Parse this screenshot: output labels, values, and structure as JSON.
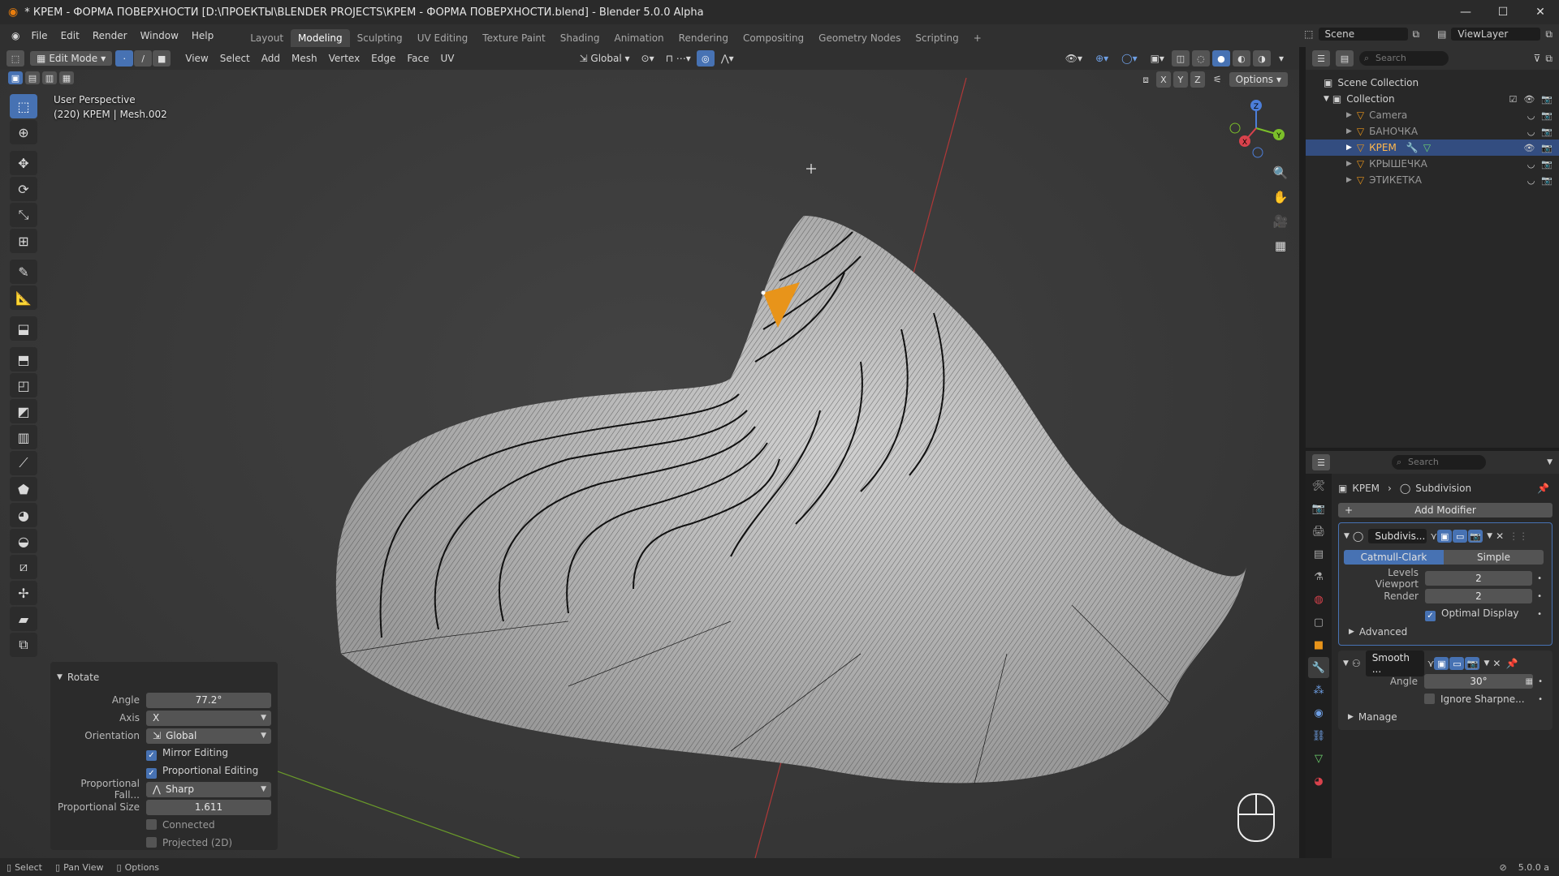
{
  "window": {
    "title": "* КРЕМ - ФОРМА ПОВЕРХНОСТИ [D:\\ПРОЕКТЫ\\BLENDER PROJECTS\\КРЕМ - ФОРМА ПОВЕРХНОСТИ.blend] - Blender 5.0.0 Alpha"
  },
  "menu": [
    "File",
    "Edit",
    "Render",
    "Window",
    "Help"
  ],
  "workspaces": [
    "Layout",
    "Modeling",
    "Sculpting",
    "UV Editing",
    "Texture Paint",
    "Shading",
    "Animation",
    "Rendering",
    "Compositing",
    "Geometry Nodes",
    "Scripting"
  ],
  "active_workspace": "Modeling",
  "scene": {
    "name": "Scene",
    "view_layer": "ViewLayer"
  },
  "viewport_header": {
    "mode": "Edit Mode",
    "menus": [
      "View",
      "Select",
      "Add",
      "Mesh",
      "Vertex",
      "Edge",
      "Face",
      "UV"
    ],
    "orientation": "Global",
    "options": "Options",
    "axes": [
      "X",
      "Y",
      "Z"
    ]
  },
  "viewport": {
    "view_name": "User Perspective",
    "object_info": "(220) КРЕМ | Mesh.002"
  },
  "gizmo": {
    "x": "X",
    "y": "Y",
    "z": "Z"
  },
  "redo_panel": {
    "title": "Rotate",
    "angle_label": "Angle",
    "angle": "77.2°",
    "axis_label": "Axis",
    "axis": "X",
    "orientation_label": "Orientation",
    "orientation": "Global",
    "mirror_editing": "Mirror Editing",
    "proportional_editing": "Proportional Editing",
    "falloff_label": "Proportional Fall...",
    "falloff": "Sharp",
    "size_label": "Proportional Size",
    "size": "1.611",
    "connected": "Connected",
    "projected": "Projected (2D)"
  },
  "outliner": {
    "search": "Search",
    "scene_collection": "Scene Collection",
    "collection": "Collection",
    "items": [
      {
        "name": "Camera"
      },
      {
        "name": "БАНОЧКА"
      },
      {
        "name": "КРЕМ"
      },
      {
        "name": "КРЫШЕЧКА"
      },
      {
        "name": "ЭТИКЕТКА"
      }
    ]
  },
  "properties": {
    "search": "Search",
    "object": "КРЕМ",
    "modifier": "Subdivision",
    "add_modifier": "Add Modifier",
    "subdiv": {
      "name": "Subdivis...",
      "catmull": "Catmull-Clark",
      "simple": "Simple",
      "levels_label": "Levels Viewport",
      "levels": "2",
      "render_label": "Render",
      "render": "2",
      "optimal": "Optimal Display",
      "advanced": "Advanced"
    },
    "smooth": {
      "name": "Smooth ...",
      "angle_label": "Angle",
      "angle": "30°",
      "ignore": "Ignore Sharpne...",
      "manage": "Manage"
    }
  },
  "status": {
    "select": "Select",
    "pan": "Pan View",
    "options": "Options",
    "version": "5.0.0 a"
  }
}
